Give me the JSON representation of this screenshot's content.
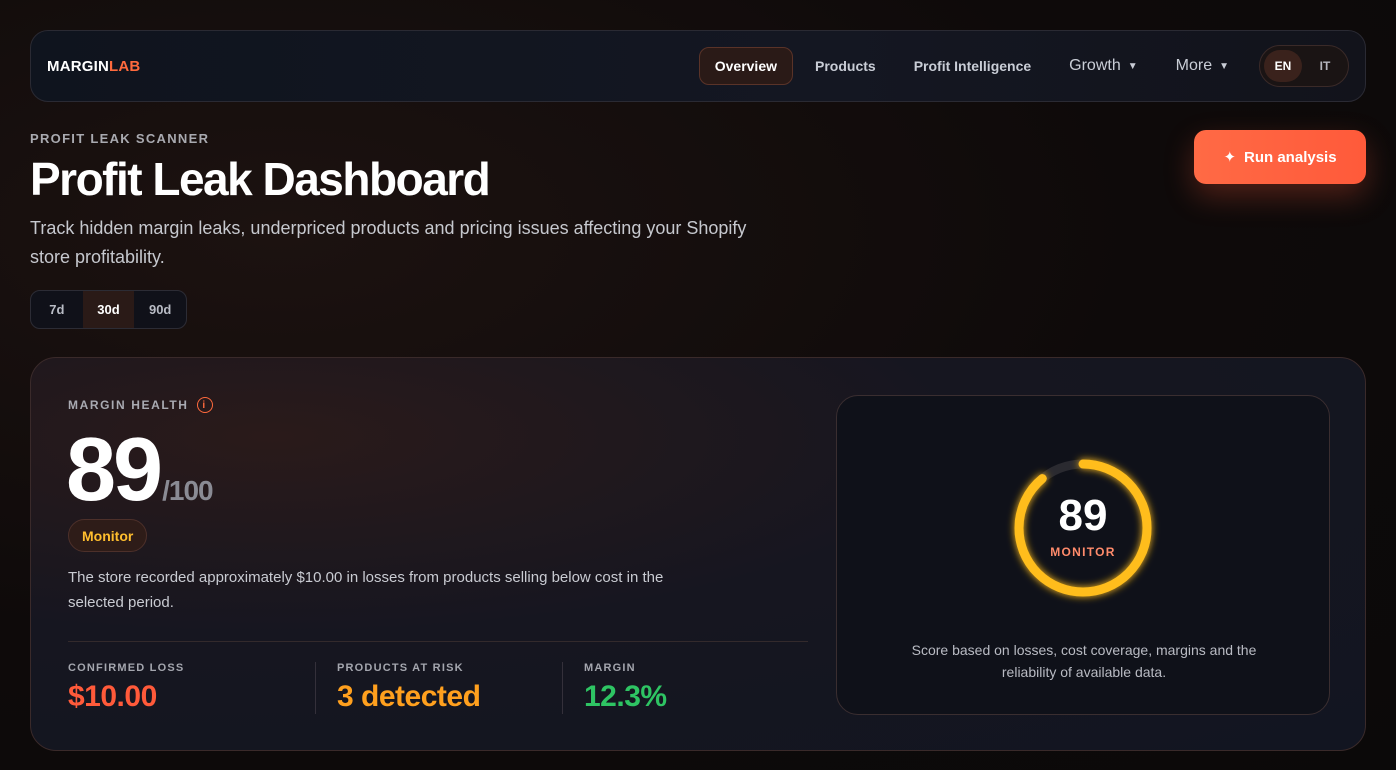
{
  "brand": {
    "name_part1": "MARGIN",
    "name_part2": "LAB",
    "accent_color": "#ff6a3d"
  },
  "nav": {
    "items": [
      {
        "label": "Overview",
        "active": true
      },
      {
        "label": "Products"
      },
      {
        "label": "Profit Intelligence"
      },
      {
        "label": "Growth",
        "dropdown": true
      },
      {
        "label": "More",
        "dropdown": true
      }
    ],
    "languages": [
      {
        "label": "EN",
        "active": true
      },
      {
        "label": "IT"
      }
    ]
  },
  "header": {
    "eyebrow": "PROFIT LEAK SCANNER",
    "title": "Profit Leak Dashboard",
    "subtitle": "Track hidden margin leaks, underpriced products and pricing issues affecting your Shopify store profitability.",
    "run_button": "Run analysis",
    "run_icon": "sparkle-icon"
  },
  "periods": [
    {
      "label": "7d"
    },
    {
      "label": "30d",
      "active": true
    },
    {
      "label": "90d"
    }
  ],
  "margin_health": {
    "label": "MARGIN HEALTH",
    "info_glyph": "i",
    "score": "89",
    "max": "/100",
    "status": "Monitor",
    "description": "The store recorded approximately $10.00 in losses from products selling below cost in the selected period.",
    "stats": [
      {
        "label": "CONFIRMED LOSS",
        "value": "$10.00",
        "color": "#ff5a3a"
      },
      {
        "label": "PRODUCTS AT RISK",
        "value": "3 detected",
        "color": "#ffa01e"
      },
      {
        "label": "MARGIN",
        "value": "12.3%",
        "color": "#2ec463"
      }
    ]
  },
  "score_panel": {
    "score": "89",
    "status": "MONITOR",
    "score_fraction": 0.89,
    "ring_color": "#ffbd1f",
    "caption": "Score based on losses, cost coverage, margins and the reliability of available data."
  }
}
